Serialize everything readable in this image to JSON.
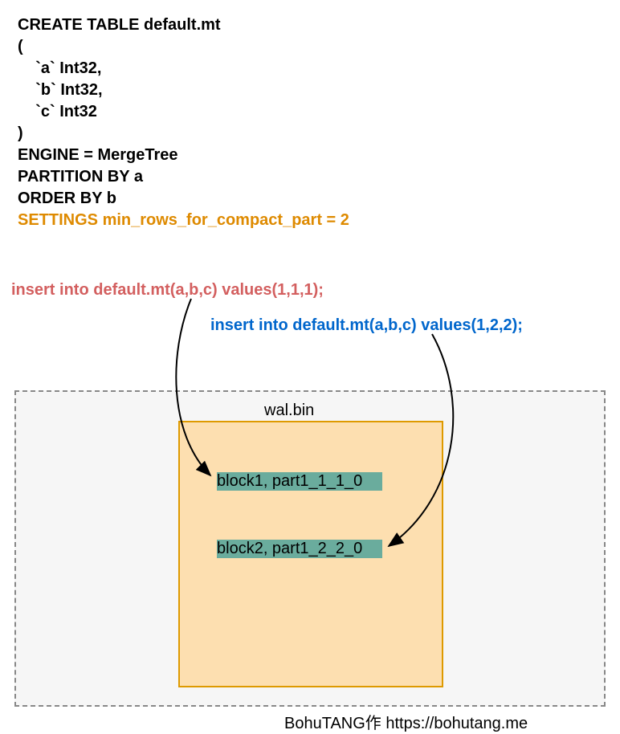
{
  "sql": {
    "line1": "CREATE TABLE default.mt",
    "line2": "(",
    "line3": "    `a` Int32,",
    "line4": "    `b` Int32,",
    "line5": "    `c` Int32",
    "line6": ")",
    "line7": "ENGINE = MergeTree",
    "line8": "PARTITION BY a",
    "line9": "ORDER BY b",
    "settings": "SETTINGS min_rows_for_compact_part = 2"
  },
  "inserts": {
    "one": "insert into default.mt(a,b,c) values(1,1,1);",
    "two": "insert into default.mt(a,b,c) values(1,2,2);"
  },
  "wal": {
    "label": "wal.bin",
    "block1": "block1, part1_1_1_0",
    "block2": "block2, part1_2_2_0"
  },
  "credit": "BohuTANG作 https://bohutang.me",
  "colors": {
    "settings": "#de8a00",
    "insert1": "#d35f5f",
    "insert2": "#0066cc",
    "walBorder": "#de9a00",
    "walFill": "#fddfb0",
    "blockFill": "#6aac9d",
    "outerBorder": "#888888",
    "outerFill": "#f6f6f6"
  }
}
